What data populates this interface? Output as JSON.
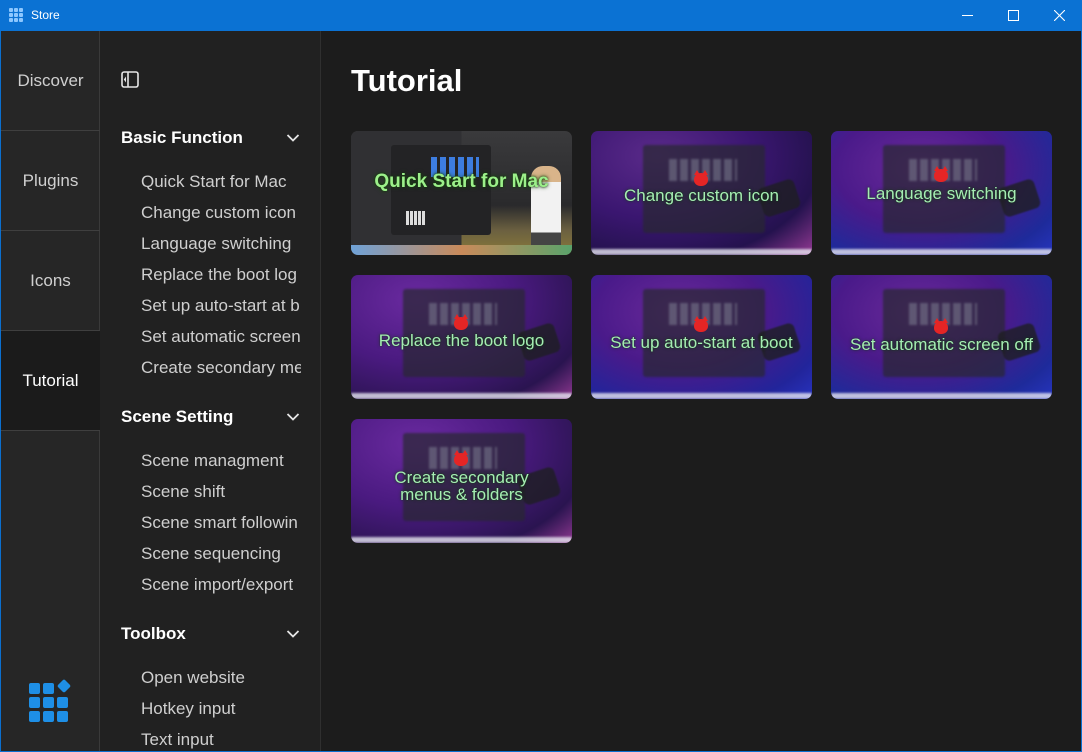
{
  "window": {
    "title": "Store"
  },
  "nav": {
    "items": [
      {
        "label": "Discover"
      },
      {
        "label": "Plugins"
      },
      {
        "label": "Icons"
      },
      {
        "label": "Tutorial",
        "active": true
      }
    ]
  },
  "sidebar": {
    "sections": [
      {
        "title": "Basic Function",
        "items": [
          "Quick Start for Mac",
          "Change custom icon",
          "Language switching",
          "Replace the boot log",
          "Set up auto-start at b",
          "Set automatic screen",
          "Create secondary me"
        ]
      },
      {
        "title": "Scene Setting",
        "items": [
          "Scene managment",
          "Scene shift",
          "Scene smart followin",
          "Scene sequencing",
          "Scene import/export"
        ]
      },
      {
        "title": "Toolbox",
        "items": [
          "Open website",
          "Hotkey input",
          "Text input"
        ]
      }
    ]
  },
  "main": {
    "title": "Tutorial",
    "cards": [
      {
        "label": "Quick Start for Mac"
      },
      {
        "label": "Change custom icon"
      },
      {
        "label": "Language switching"
      },
      {
        "label": "Replace the boot logo"
      },
      {
        "label": "Set up auto-start at boot"
      },
      {
        "label": "Set automatic screen off"
      },
      {
        "label": "Create secondary menus & folders"
      }
    ]
  },
  "colors": {
    "titlebar": "#0b72d3",
    "accent": "#1e8fe6",
    "label_green": "#a6ecb4"
  }
}
